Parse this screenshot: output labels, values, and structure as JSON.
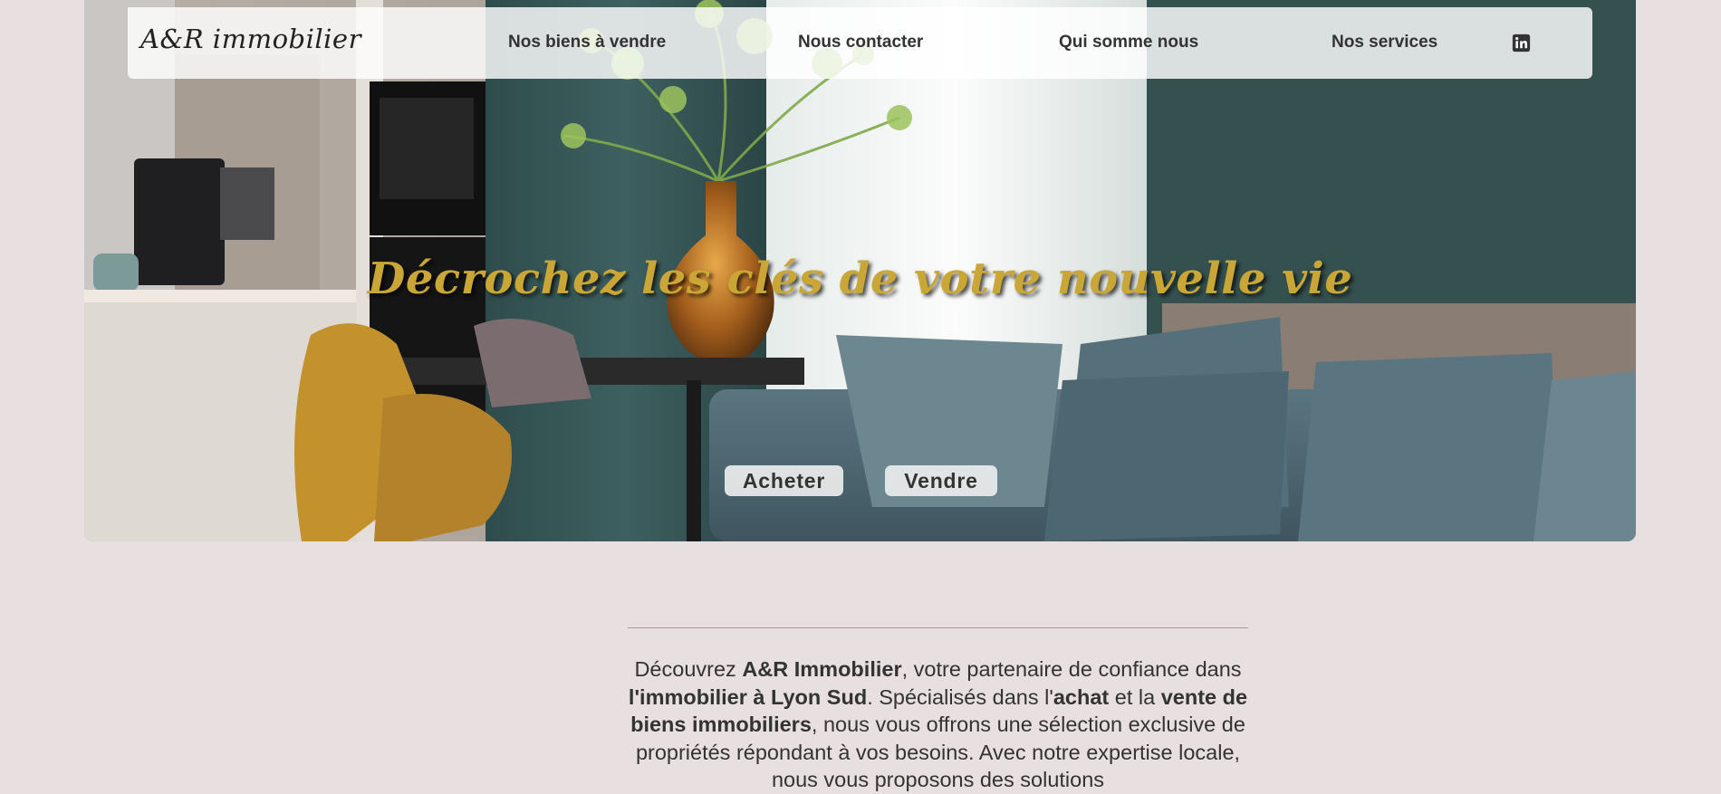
{
  "brand": {
    "logo": "A&R immobilier"
  },
  "nav": {
    "items": [
      "Nos biens à vendre",
      "Nous contacter",
      "Qui somme nous",
      "Nos services"
    ],
    "social_icon": "linkedin-icon"
  },
  "hero": {
    "title": "Décrochez les clés de votre nouvelle vie",
    "buttons": {
      "buy": "Acheter",
      "sell": "Vendre"
    }
  },
  "intro": {
    "p1": "Découvrez ",
    "b1": "A&R Immobilier",
    "p2": ", votre partenaire de confiance dans ",
    "b2": "l'immobilier à Lyon Sud",
    "p3": ". Spécialisés dans l'",
    "b3": "achat",
    "p4": " et la ",
    "b4": "vente de biens immobiliers",
    "p5": ", nous vous offrons une sélection exclusive de propriétés répondant à vos besoins. Avec notre expertise locale, nous vous proposons des solutions"
  },
  "colors": {
    "page_bg": "#e8dfe0",
    "title_gold": "#c9a636",
    "divider": "#a89a8f"
  }
}
